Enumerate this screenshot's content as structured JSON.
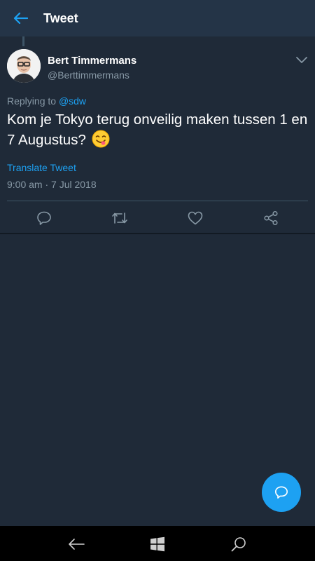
{
  "header": {
    "title": "Tweet",
    "back_icon": "arrow-left-icon"
  },
  "tweet": {
    "display_name": "Bert Timmermans",
    "handle": "@Berttimmermans",
    "replying_prefix": "Replying to",
    "replying_to": "@sdw",
    "text": "Kom je Tokyo terug onveilig maken tussen 1 en 7 Augustus?",
    "emoji": "face-savoring-food-emoji",
    "translate_label": "Translate Tweet",
    "timestamp": "9:00 am · 7 Jul 2018"
  },
  "actions": [
    "reply-icon",
    "retweet-icon",
    "like-icon",
    "share-icon"
  ],
  "navbar": [
    "back-arrow-icon",
    "windows-start-icon",
    "search-icon"
  ],
  "colors": {
    "background": "#1f2a38",
    "header": "#243447",
    "accent": "#1da1f2",
    "secondary_text": "#8899a6",
    "nav_bar": "#000000"
  }
}
